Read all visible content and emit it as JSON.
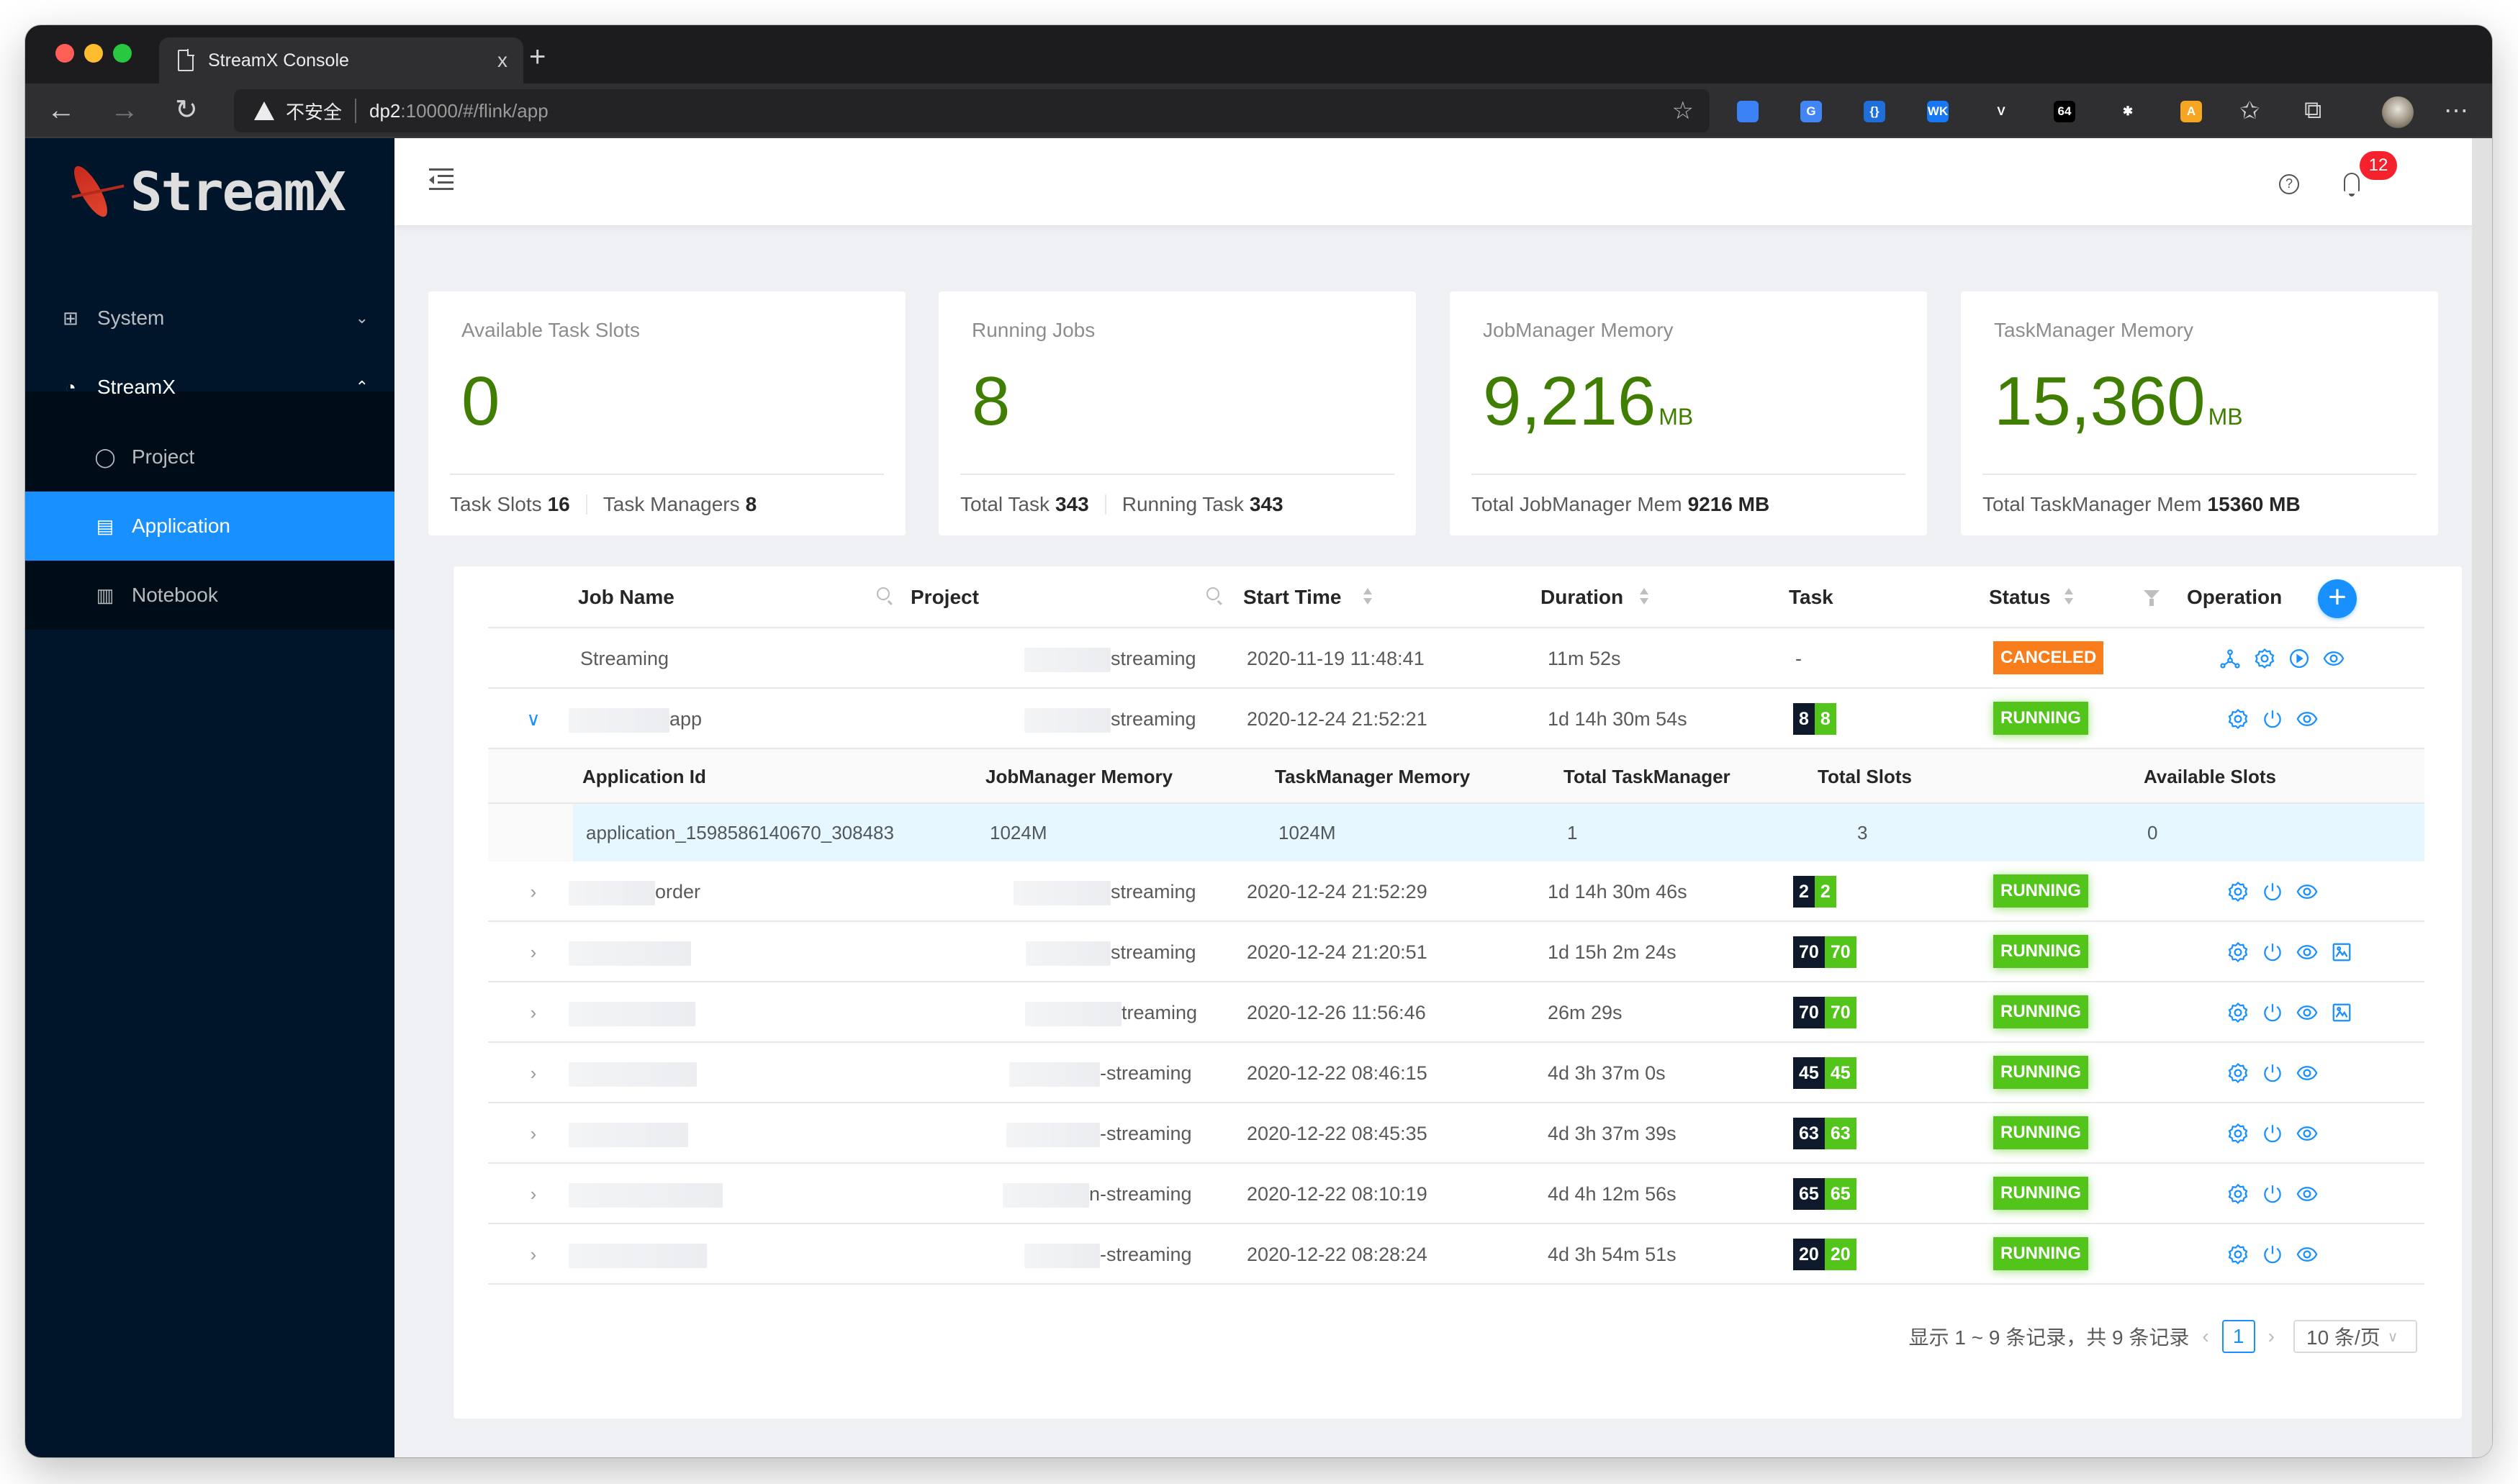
{
  "browser": {
    "tab_title": "StreamX Console",
    "tab_close": "x",
    "new_tab": "+",
    "insecure_label": "不安全",
    "url_host": "dp2",
    "url_path": ":10000/#/flink/app",
    "extensions": [
      {
        "name": "ext-badge",
        "label": "",
        "color": "#3b82f6"
      },
      {
        "name": "ext-google-translate",
        "label": "G",
        "color": "#4285f4"
      },
      {
        "name": "ext-json",
        "label": "{}",
        "color": "#1e6fd9"
      },
      {
        "name": "ext-wk",
        "label": "WK",
        "color": "#1877f2"
      },
      {
        "name": "ext-vue",
        "label": "V",
        "color": "#2f2f31"
      },
      {
        "name": "ext-base64",
        "label": "64",
        "color": "#000000"
      },
      {
        "name": "ext-colorful",
        "label": "✱",
        "color": "#2f2f31"
      },
      {
        "name": "ext-translate",
        "label": "A",
        "color": "#f5a623"
      }
    ]
  },
  "sidebar": {
    "logo_text": "StreamX",
    "items": [
      {
        "label": "System",
        "icon": "appstore-icon",
        "arrow": "⌄",
        "level": "top"
      },
      {
        "label": "StreamX",
        "icon": "dashboard-icon",
        "arrow": "⌃",
        "level": "top"
      },
      {
        "label": "Project",
        "icon": "github-icon",
        "level": "sub"
      },
      {
        "label": "Application",
        "icon": "app-file-icon",
        "level": "sub",
        "active": true
      },
      {
        "label": "Notebook",
        "icon": "book-icon",
        "level": "sub"
      }
    ]
  },
  "header": {
    "notification_count": "12",
    "help_glyph": "?"
  },
  "cards": [
    {
      "title": "Available Task Slots",
      "value": "0",
      "unit": "",
      "footer": [
        {
          "label": "Task Slots",
          "value": "16"
        },
        {
          "label": "Task Managers",
          "value": "8"
        }
      ]
    },
    {
      "title": "Running Jobs",
      "value": "8",
      "unit": "",
      "footer": [
        {
          "label": "Total Task",
          "value": "343"
        },
        {
          "label": "Running Task",
          "value": "343"
        }
      ]
    },
    {
      "title": "JobManager Memory",
      "value": "9,216",
      "unit": "MB",
      "footer": [
        {
          "label": "Total JobManager Mem",
          "value": "9216 MB"
        }
      ]
    },
    {
      "title": "TaskManager Memory",
      "value": "15,360",
      "unit": "MB",
      "footer": [
        {
          "label": "Total TaskManager Mem",
          "value": "15360 MB"
        }
      ]
    }
  ],
  "table": {
    "columns": {
      "job_name": "Job Name",
      "project": "Project",
      "start_time": "Start Time",
      "duration": "Duration",
      "task": "Task",
      "status": "Status",
      "operation": "Operation"
    },
    "add_button": "+",
    "rows": [
      {
        "job_name": "Streaming",
        "job_redact": 0,
        "project": "streaming",
        "project_redact": 120,
        "start_time": "2020-11-19 11:48:41",
        "duration": "11m 52s",
        "task_total": "",
        "task_running": "",
        "task_dash": "-",
        "status": "CANCELED",
        "ops": [
          "deploy",
          "setting",
          "start",
          "view"
        ],
        "expanded": false,
        "collapsible": false
      },
      {
        "job_name": "app",
        "job_redact": 140,
        "project": "streaming",
        "project_redact": 120,
        "start_time": "2020-12-24 21:52:21",
        "duration": "1d 14h 30m 54s",
        "task_total": "8",
        "task_running": "8",
        "status": "RUNNING",
        "ops": [
          "setting",
          "stop",
          "view"
        ],
        "expanded": true,
        "collapsible": true
      },
      {
        "job_name": "order",
        "job_redact": 120,
        "project": "streaming",
        "project_redact": 135,
        "start_time": "2020-12-24 21:52:29",
        "duration": "1d 14h 30m 46s",
        "task_total": "2",
        "task_running": "2",
        "status": "RUNNING",
        "ops": [
          "setting",
          "stop",
          "view"
        ],
        "expanded": false,
        "collapsible": true
      },
      {
        "job_name": "",
        "job_redact": 170,
        "project": "streaming",
        "project_redact": 118,
        "start_time": "2020-12-24 21:20:51",
        "duration": "1d 15h 2m 24s",
        "task_total": "70",
        "task_running": "70",
        "status": "RUNNING",
        "ops": [
          "setting",
          "stop",
          "view",
          "flame"
        ],
        "expanded": false,
        "collapsible": true
      },
      {
        "job_name": "",
        "job_redact": 176,
        "project": "treaming",
        "project_redact": 134,
        "start_time": "2020-12-26 11:56:46",
        "duration": "26m 29s",
        "task_total": "70",
        "task_running": "70",
        "status": "RUNNING",
        "ops": [
          "setting",
          "stop",
          "view",
          "flame"
        ],
        "expanded": false,
        "collapsible": true
      },
      {
        "job_name": "",
        "job_redact": 178,
        "project": "-streaming",
        "project_redact": 126,
        "start_time": "2020-12-22 08:46:15",
        "duration": "4d 3h 37m 0s",
        "task_total": "45",
        "task_running": "45",
        "status": "RUNNING",
        "ops": [
          "setting",
          "stop",
          "view"
        ],
        "expanded": false,
        "collapsible": true
      },
      {
        "job_name": "",
        "job_redact": 166,
        "project": "-streaming",
        "project_redact": 130,
        "start_time": "2020-12-22 08:45:35",
        "duration": "4d 3h 37m 39s",
        "task_total": "63",
        "task_running": "63",
        "status": "RUNNING",
        "ops": [
          "setting",
          "stop",
          "view"
        ],
        "expanded": false,
        "collapsible": true
      },
      {
        "job_name": "",
        "job_redact": 214,
        "project": "n-streaming",
        "project_redact": 120,
        "start_time": "2020-12-22 08:10:19",
        "duration": "4d 4h 12m 56s",
        "task_total": "65",
        "task_running": "65",
        "status": "RUNNING",
        "ops": [
          "setting",
          "stop",
          "view"
        ],
        "expanded": false,
        "collapsible": true
      },
      {
        "job_name": "",
        "job_redact": 192,
        "project": "-streaming",
        "project_redact": 105,
        "start_time": "2020-12-22 08:28:24",
        "duration": "4d 3h 54m 51s",
        "task_total": "20",
        "task_running": "20",
        "status": "RUNNING",
        "ops": [
          "setting",
          "stop",
          "view"
        ],
        "expanded": false,
        "collapsible": true
      }
    ],
    "detail": {
      "columns": [
        "Application Id",
        "JobManager Memory",
        "TaskManager Memory",
        "Total TaskManager",
        "Total Slots",
        "Available Slots"
      ],
      "values": [
        "application_1598586140670_308483",
        "1024M",
        "1024M",
        "1",
        "3",
        "0"
      ]
    }
  },
  "pagination": {
    "summary": "显示 1 ~ 9 条记录，共 9 条记录",
    "prev": "‹",
    "current_page": "1",
    "next": "›",
    "page_size": "10 条/页"
  },
  "colors": {
    "running": "#52c41a",
    "canceled": "#fa7d1b",
    "accent": "#1890ff",
    "sidebar_bg": "#001529",
    "metric_green": "#3f7e00"
  }
}
